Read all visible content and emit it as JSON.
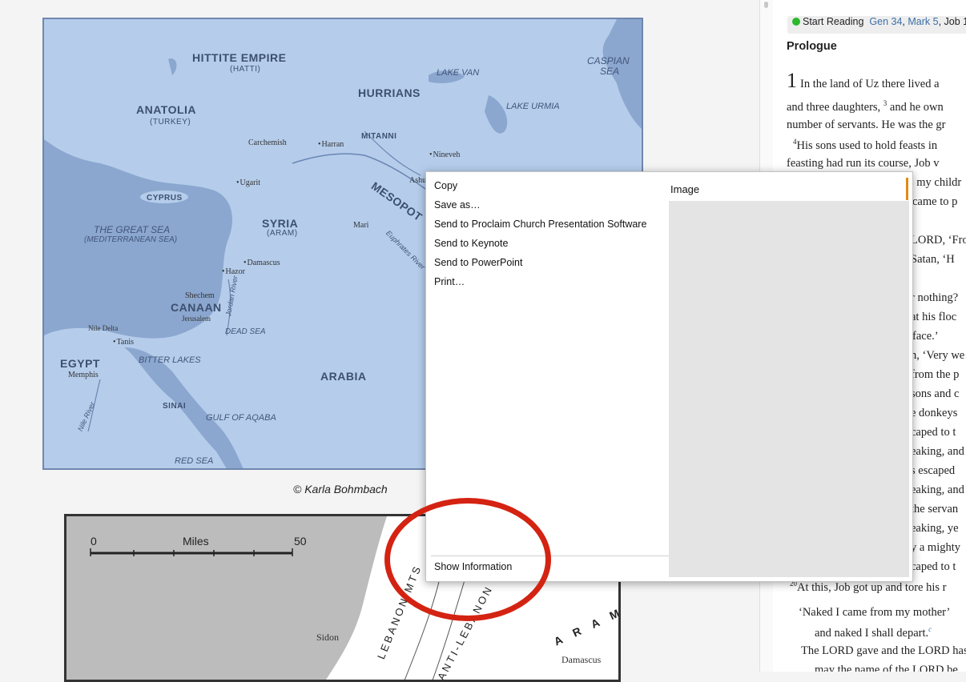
{
  "map1": {
    "regions": {
      "hittite": "HITTITE EMPIRE",
      "hatti": "(HATTI)",
      "hurrians": "HURRIANS",
      "anatolia": "ANATOLIA",
      "turkey": "(TURKEY)",
      "mitanni": "MITANNI",
      "mesopotamia": "MESOPOT",
      "syria": "SYRIA",
      "aram": "(ARAM)",
      "canaan": "CANAAN",
      "egypt": "EGYPT",
      "arabia": "ARABIA",
      "sinai": "SINAI",
      "cyprus": "CYPRUS"
    },
    "seas": {
      "lake_van": "LAKE VAN",
      "lake_urmia": "LAKE URMIA",
      "caspian": "CASPIAN",
      "caspian2": "SEA",
      "great_sea": "THE GREAT SEA",
      "mediterranean": "(MEDITERRANEAN SEA)",
      "dead_sea": "DEAD SEA",
      "bitter_lakes": "BITTER LAKES",
      "gulf_aqaba": "GULF OF AQABA",
      "red_sea": "RED SEA",
      "euphrates": "Euphrates River",
      "jordan": "Jordan River",
      "nile": "Nile River"
    },
    "cities": {
      "carchemish": "Carchemish",
      "harran": "Harran",
      "nineveh": "Nineveh",
      "ashur": "Ashu",
      "ugarit": "Ugarit",
      "mari": "Mari",
      "damascus": "Damascus",
      "hazor": "Hazor",
      "shechem": "Shechem",
      "jerusalem": "Jerusalem",
      "nile_delta": "Nile Delta",
      "tanis": "Tanis",
      "memphis": "Memphis"
    }
  },
  "credit": "© Karla Bohmbach",
  "map2": {
    "scale_zero": "0",
    "scale_unit": "Miles",
    "scale_max": "50",
    "sidon": "Sidon",
    "damascus": "Damascus",
    "lebanon_mts": "LEBANON MTS",
    "anti_lebanon": "ANTI-LEBANON",
    "aram_letters": "A R A M"
  },
  "reader": {
    "start_label": "Start Reading",
    "ref1": "Gen 34",
    "ref2": "Mark 5",
    "ref3": "Job 1",
    "heading": "Prologue",
    "chapter": "1",
    "lines": [
      "In the land of Uz there lived a",
      "and three daughters, ",
      "number of servants. He was the gr",
      "His sons used to hold feasts in",
      "feasting had run its course, Job v",
      "s my childr",
      "came to p",
      "LORD, ‘From",
      "Satan, ‘H",
      "r nothing?",
      "at his floc",
      "face.’",
      "n, ‘Very we",
      "from the p",
      "sons and c",
      "e donkeys",
      "caped to t",
      "eaking, and",
      "s escaped",
      "eaking, and",
      "the servan",
      "eaking, ye",
      "y a mighty",
      "caped to t",
      "At this, Job got up and tore his r",
      "‘Naked I came from my mother’",
      "and naked I shall depart.",
      "The LORD gave and the LORD has",
      "may the name of the LORD be"
    ],
    "line2_rest": "and he own",
    "sup3": "3",
    "sup4": "4",
    "sup20": "20",
    "supc": "c"
  },
  "context_menu": {
    "items": [
      "Copy",
      "Save as…",
      "Send to Proclaim Church Presentation Software",
      "Send to Keynote",
      "Send to PowerPoint",
      "Print…"
    ],
    "show_info": "Show Information",
    "preview_title": "Image"
  }
}
